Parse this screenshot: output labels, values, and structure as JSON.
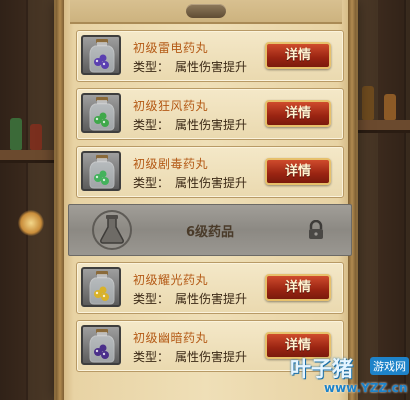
{
  "items_top": [
    {
      "name": "初级雷电药丸",
      "type_label": "类型：",
      "type_value": "属性伤害提升",
      "button": "详情",
      "potion_color": "#5a3fb0",
      "icon": "purple-potion-icon"
    },
    {
      "name": "初级狂风药丸",
      "type_label": "类型：",
      "type_value": "属性伤害提升",
      "button": "详情",
      "potion_color": "#3fa84a",
      "icon": "green-potion-icon"
    },
    {
      "name": "初级剧毒药丸",
      "type_label": "类型：",
      "type_value": "属性伤害提升",
      "button": "详情",
      "potion_color": "#43b25c",
      "icon": "green-potion-icon"
    }
  ],
  "tier": {
    "label": "6级药品",
    "locked": true
  },
  "items_bottom": [
    {
      "name": "初级耀光药丸",
      "type_label": "类型：",
      "type_value": "属性伤害提升",
      "button": "详情",
      "potion_color": "#d9b22a",
      "icon": "yellow-potion-icon"
    },
    {
      "name": "初级幽暗药丸",
      "type_label": "类型：",
      "type_value": "属性伤害提升",
      "button": "详情",
      "potion_color": "#4a2f8a",
      "icon": "purple-potion-icon"
    }
  ],
  "watermark": {
    "brand": "叶子猪",
    "sub": "游戏网",
    "url": "www.YZZ.cn"
  },
  "colors": {
    "name_text": "#b45a16",
    "button_bg": "#9a2412",
    "button_border": "#e7c06b"
  }
}
